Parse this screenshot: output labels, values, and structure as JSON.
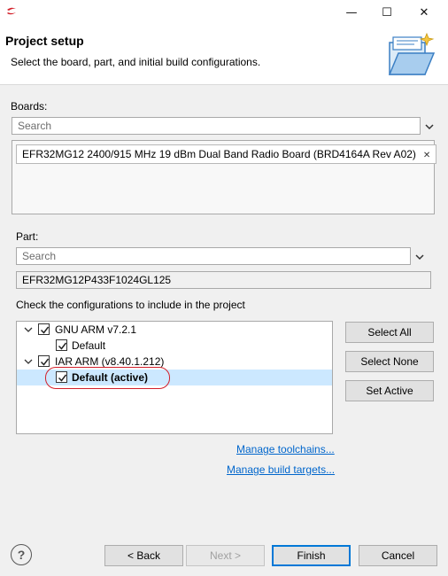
{
  "window": {
    "minimize": "—",
    "maximize": "☐",
    "close": "✕"
  },
  "header": {
    "title": "Project setup",
    "description": "Select the board, part, and initial build configurations."
  },
  "boards": {
    "label": "Boards:",
    "search_placeholder": "Search",
    "selected": [
      "EFR32MG12 2400/915 MHz 19 dBm Dual Band Radio Board (BRD4164A Rev A02)"
    ]
  },
  "part": {
    "label": "Part:",
    "search_placeholder": "Search",
    "value": "EFR32MG12P433F1024GL125"
  },
  "configs": {
    "label": "Check the configurations to include in the project",
    "tree": [
      {
        "label": "GNU ARM v7.2.1",
        "checked": true,
        "expanded": true
      },
      {
        "label": "Default",
        "checked": true
      },
      {
        "label": "IAR ARM (v8.40.1.212)",
        "checked": true,
        "expanded": true
      },
      {
        "label": "Default (active)",
        "checked": true,
        "selected": true
      }
    ],
    "buttons": {
      "select_all": "Select All",
      "select_none": "Select None",
      "set_active": "Set Active"
    }
  },
  "links": {
    "manage_toolchains": "Manage toolchains...",
    "manage_build_targets": "Manage build targets..."
  },
  "footer": {
    "help": "?",
    "back": "< Back",
    "next": "Next >",
    "finish": "Finish",
    "cancel": "Cancel"
  },
  "colors": {
    "accent": "#0078d7",
    "selection": "#cce8ff",
    "link": "#0066cc",
    "highlight_oval": "#d3202a"
  }
}
